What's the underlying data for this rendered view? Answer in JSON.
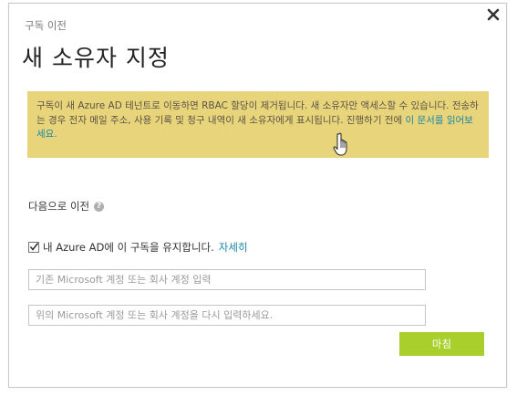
{
  "dialog": {
    "eyebrow": "구독 이전",
    "title": "새 소유자 지정",
    "close_icon": "close-icon"
  },
  "warning": {
    "text": "구독이 새 Azure AD 테넌트로 이동하면 RBAC 할당이 제거됩니다. 새 소유자만 액세스할 수 있습니다. 전송하는 경우 전자 메일 주소, 사용 기록 및 청구 내역이 새 소유자에게 표시됩니다. 진행하기 전에 ",
    "link": "이 문서를 읽어보세요.",
    "background": "#e8d47a"
  },
  "move_to": {
    "label": "다음으로 이전",
    "help_glyph": "?"
  },
  "keep": {
    "checked": true,
    "label": "내 Azure AD에 이 구독을 유지합니다.",
    "link": "자세히"
  },
  "inputs": {
    "account_placeholder": "기존 Microsoft 계정 또는 회사 계정 입력",
    "confirm_placeholder": "위의 Microsoft 계정 또는 회사 계정을 다시 입력하세요."
  },
  "actions": {
    "finish": "마침",
    "accent": "#a8cf2b"
  }
}
